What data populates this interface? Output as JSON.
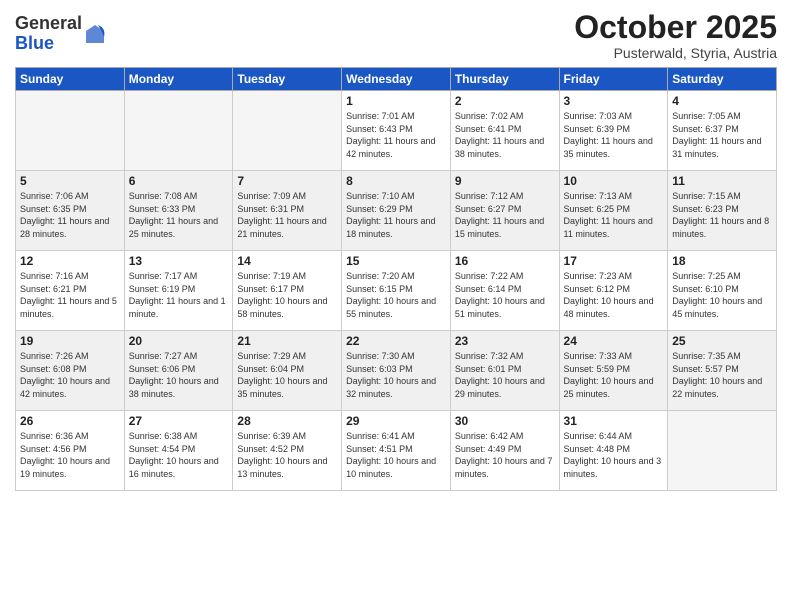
{
  "header": {
    "logo_general": "General",
    "logo_blue": "Blue",
    "month_title": "October 2025",
    "subtitle": "Pusterwald, Styria, Austria"
  },
  "weekdays": [
    "Sunday",
    "Monday",
    "Tuesday",
    "Wednesday",
    "Thursday",
    "Friday",
    "Saturday"
  ],
  "weeks": [
    {
      "shaded": false,
      "days": [
        {
          "number": "",
          "info": ""
        },
        {
          "number": "",
          "info": ""
        },
        {
          "number": "",
          "info": ""
        },
        {
          "number": "1",
          "info": "Sunrise: 7:01 AM\nSunset: 6:43 PM\nDaylight: 11 hours\nand 42 minutes."
        },
        {
          "number": "2",
          "info": "Sunrise: 7:02 AM\nSunset: 6:41 PM\nDaylight: 11 hours\nand 38 minutes."
        },
        {
          "number": "3",
          "info": "Sunrise: 7:03 AM\nSunset: 6:39 PM\nDaylight: 11 hours\nand 35 minutes."
        },
        {
          "number": "4",
          "info": "Sunrise: 7:05 AM\nSunset: 6:37 PM\nDaylight: 11 hours\nand 31 minutes."
        }
      ]
    },
    {
      "shaded": true,
      "days": [
        {
          "number": "5",
          "info": "Sunrise: 7:06 AM\nSunset: 6:35 PM\nDaylight: 11 hours\nand 28 minutes."
        },
        {
          "number": "6",
          "info": "Sunrise: 7:08 AM\nSunset: 6:33 PM\nDaylight: 11 hours\nand 25 minutes."
        },
        {
          "number": "7",
          "info": "Sunrise: 7:09 AM\nSunset: 6:31 PM\nDaylight: 11 hours\nand 21 minutes."
        },
        {
          "number": "8",
          "info": "Sunrise: 7:10 AM\nSunset: 6:29 PM\nDaylight: 11 hours\nand 18 minutes."
        },
        {
          "number": "9",
          "info": "Sunrise: 7:12 AM\nSunset: 6:27 PM\nDaylight: 11 hours\nand 15 minutes."
        },
        {
          "number": "10",
          "info": "Sunrise: 7:13 AM\nSunset: 6:25 PM\nDaylight: 11 hours\nand 11 minutes."
        },
        {
          "number": "11",
          "info": "Sunrise: 7:15 AM\nSunset: 6:23 PM\nDaylight: 11 hours\nand 8 minutes."
        }
      ]
    },
    {
      "shaded": false,
      "days": [
        {
          "number": "12",
          "info": "Sunrise: 7:16 AM\nSunset: 6:21 PM\nDaylight: 11 hours\nand 5 minutes."
        },
        {
          "number": "13",
          "info": "Sunrise: 7:17 AM\nSunset: 6:19 PM\nDaylight: 11 hours\nand 1 minute."
        },
        {
          "number": "14",
          "info": "Sunrise: 7:19 AM\nSunset: 6:17 PM\nDaylight: 10 hours\nand 58 minutes."
        },
        {
          "number": "15",
          "info": "Sunrise: 7:20 AM\nSunset: 6:15 PM\nDaylight: 10 hours\nand 55 minutes."
        },
        {
          "number": "16",
          "info": "Sunrise: 7:22 AM\nSunset: 6:14 PM\nDaylight: 10 hours\nand 51 minutes."
        },
        {
          "number": "17",
          "info": "Sunrise: 7:23 AM\nSunset: 6:12 PM\nDaylight: 10 hours\nand 48 minutes."
        },
        {
          "number": "18",
          "info": "Sunrise: 7:25 AM\nSunset: 6:10 PM\nDaylight: 10 hours\nand 45 minutes."
        }
      ]
    },
    {
      "shaded": true,
      "days": [
        {
          "number": "19",
          "info": "Sunrise: 7:26 AM\nSunset: 6:08 PM\nDaylight: 10 hours\nand 42 minutes."
        },
        {
          "number": "20",
          "info": "Sunrise: 7:27 AM\nSunset: 6:06 PM\nDaylight: 10 hours\nand 38 minutes."
        },
        {
          "number": "21",
          "info": "Sunrise: 7:29 AM\nSunset: 6:04 PM\nDaylight: 10 hours\nand 35 minutes."
        },
        {
          "number": "22",
          "info": "Sunrise: 7:30 AM\nSunset: 6:03 PM\nDaylight: 10 hours\nand 32 minutes."
        },
        {
          "number": "23",
          "info": "Sunrise: 7:32 AM\nSunset: 6:01 PM\nDaylight: 10 hours\nand 29 minutes."
        },
        {
          "number": "24",
          "info": "Sunrise: 7:33 AM\nSunset: 5:59 PM\nDaylight: 10 hours\nand 25 minutes."
        },
        {
          "number": "25",
          "info": "Sunrise: 7:35 AM\nSunset: 5:57 PM\nDaylight: 10 hours\nand 22 minutes."
        }
      ]
    },
    {
      "shaded": false,
      "days": [
        {
          "number": "26",
          "info": "Sunrise: 6:36 AM\nSunset: 4:56 PM\nDaylight: 10 hours\nand 19 minutes."
        },
        {
          "number": "27",
          "info": "Sunrise: 6:38 AM\nSunset: 4:54 PM\nDaylight: 10 hours\nand 16 minutes."
        },
        {
          "number": "28",
          "info": "Sunrise: 6:39 AM\nSunset: 4:52 PM\nDaylight: 10 hours\nand 13 minutes."
        },
        {
          "number": "29",
          "info": "Sunrise: 6:41 AM\nSunset: 4:51 PM\nDaylight: 10 hours\nand 10 minutes."
        },
        {
          "number": "30",
          "info": "Sunrise: 6:42 AM\nSunset: 4:49 PM\nDaylight: 10 hours\nand 7 minutes."
        },
        {
          "number": "31",
          "info": "Sunrise: 6:44 AM\nSunset: 4:48 PM\nDaylight: 10 hours\nand 3 minutes."
        },
        {
          "number": "",
          "info": ""
        }
      ]
    }
  ]
}
